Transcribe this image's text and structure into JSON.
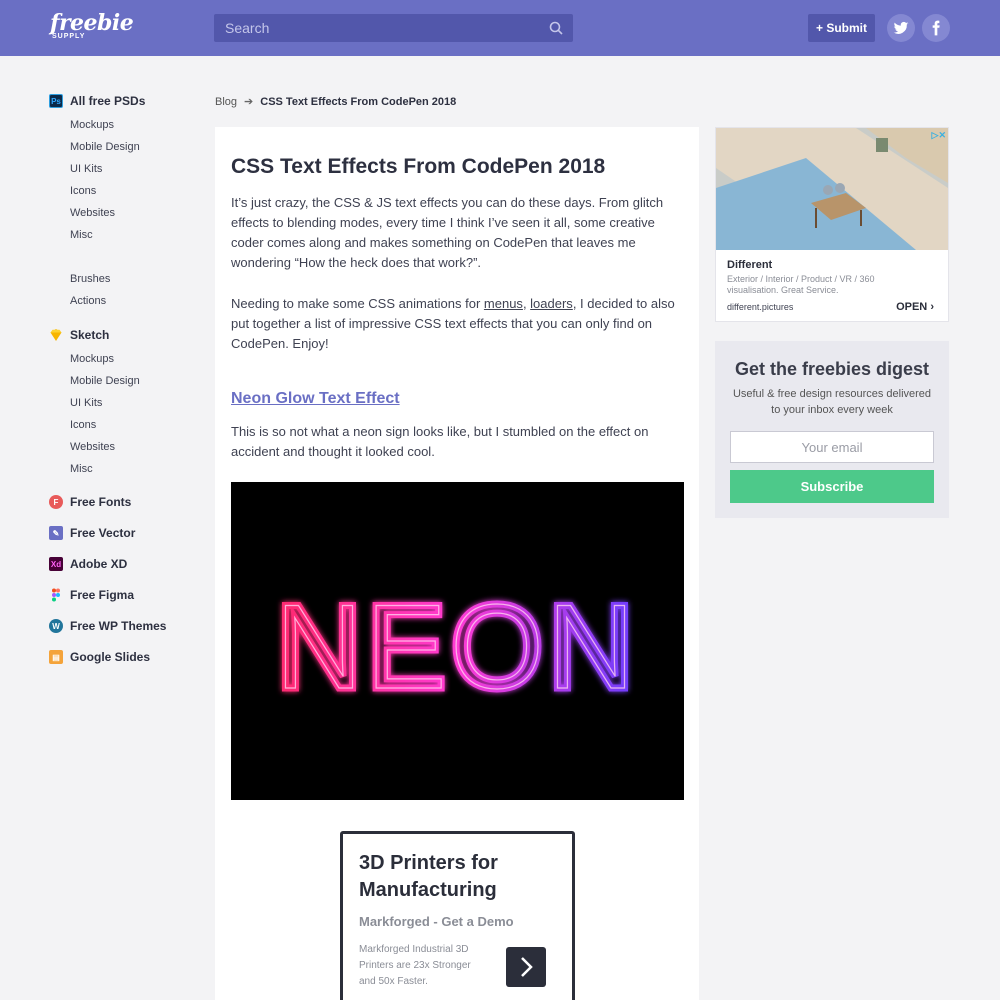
{
  "header": {
    "logo_main": "freebie",
    "logo_sub": "SUPPLY",
    "search_placeholder": "Search",
    "submit_label": "+ Submit",
    "twitter_icon": "twitter-icon",
    "facebook_icon": "facebook-icon"
  },
  "sidebar": {
    "psd": {
      "label": "All free PSDs",
      "icon": "photoshop-icon",
      "icon_text": "Ps",
      "color": "#2f9fe0"
    },
    "psd_items": [
      "Mockups",
      "Mobile Design",
      "UI Kits",
      "Icons",
      "Websites",
      "Misc"
    ],
    "psd_extra": [
      "Brushes",
      "Actions"
    ],
    "sketch": {
      "label": "Sketch",
      "icon": "sketch-icon",
      "color": "#f7b500"
    },
    "sketch_items": [
      "Mockups",
      "Mobile Design",
      "UI Kits",
      "Icons",
      "Websites",
      "Misc"
    ],
    "others": [
      {
        "label": "Free Fonts",
        "icon": "fonts-icon",
        "color": "#e85a5a"
      },
      {
        "label": "Free Vector",
        "icon": "vector-icon",
        "color": "#6a6fc4"
      },
      {
        "label": "Adobe XD",
        "icon": "adobe-xd-icon",
        "icon_text": "Xd",
        "color": "#470137"
      },
      {
        "label": "Free Figma",
        "icon": "figma-icon",
        "color": "#a259ff"
      },
      {
        "label": "Free WP Themes",
        "icon": "wordpress-icon",
        "color": "#21759b"
      },
      {
        "label": "Google Slides",
        "icon": "google-slides-icon",
        "color": "#f4a33a"
      }
    ]
  },
  "breadcrumb": {
    "root": "Blog",
    "current": "CSS Text Effects From CodePen 2018"
  },
  "article": {
    "title": "CSS Text Effects From CodePen 2018",
    "para1": "It’s just crazy, the CSS & JS text effects you can do these days. From glitch effects to blending modes, every time I think I’ve seen it all, some creative coder comes along and makes something on CodePen that leaves me wondering “How the heck does that work?”.",
    "para2_start": "Needing to make some CSS animations for ",
    "para2_link1": "menus",
    "para2_comma": ", ",
    "para2_link2": "loaders",
    "para2_end": ", I decided to also put together a list of impressive CSS text effects that you can only find on CodePen. Enjoy!",
    "section_title": "Neon Glow Text Effect",
    "section_text": "This is so not what a neon sign looks like, but I stumbled on the effect on accident and thought it looked cool.",
    "neon_text": "NEON"
  },
  "inline_ad": {
    "title": "3D Printers for Manufacturing",
    "subtitle": "Markforged - Get a Demo",
    "description": "Markforged Industrial 3D Printers are 23x Stronger and 50x Faster."
  },
  "side_ad": {
    "title": "Different",
    "description": "Exterior / Interior / Product / VR / 360 visualisation. Great Service.",
    "url": "different.pictures",
    "open_label": "OPEN"
  },
  "newsletter": {
    "title": "Get the freebies digest",
    "text": "Useful & free design resources delivered to your inbox every week",
    "email_placeholder": "Your email",
    "button_label": "Subscribe"
  }
}
